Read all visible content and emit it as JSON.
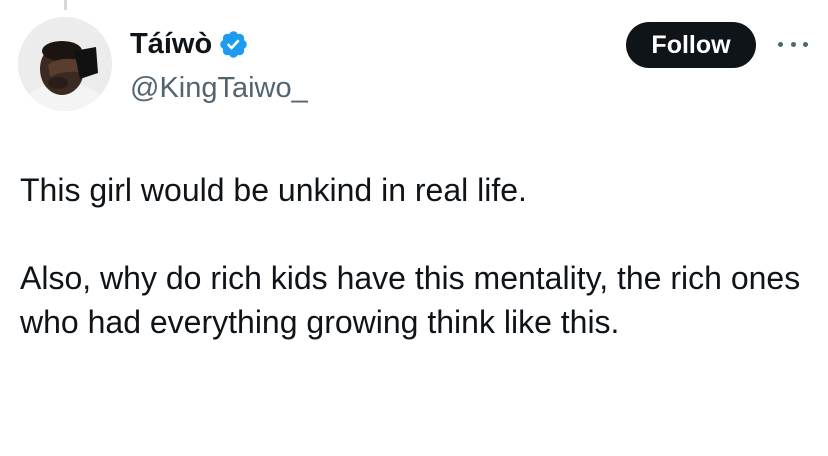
{
  "author": {
    "display_name": "Táíwò",
    "handle": "@KingTaiwo_",
    "verified": true,
    "verified_color": "#1d9bf0"
  },
  "actions": {
    "follow_label": "Follow",
    "more_icon": "more-horizontal-icon"
  },
  "tweet": {
    "paragraphs": [
      "This girl would be unkind in real life.",
      "Also, why do rich kids have this mentality, the rich ones who had everything growing think like this."
    ]
  },
  "colors": {
    "text_primary": "#0f1419",
    "text_secondary": "#536471",
    "follow_bg": "#0f1419",
    "follow_text": "#ffffff"
  }
}
